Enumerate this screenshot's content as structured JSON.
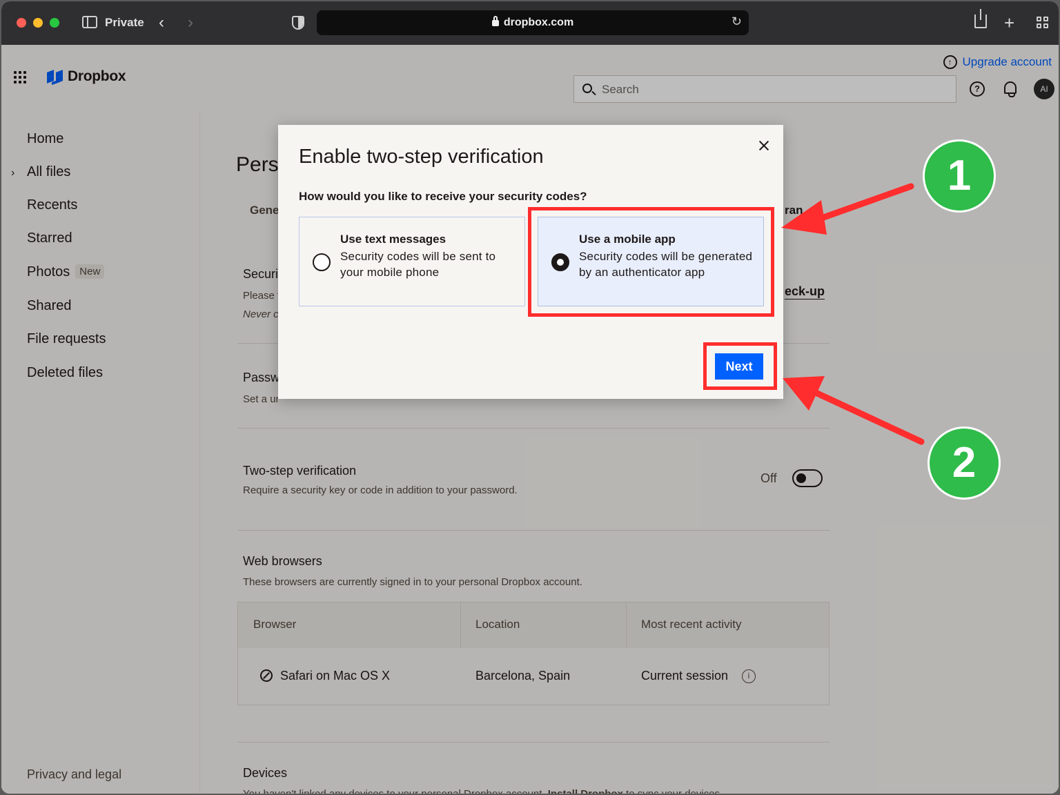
{
  "browser": {
    "mode_label": "Private",
    "url": "dropbox.com"
  },
  "header": {
    "logo_text": "Dropbox",
    "upgrade_label": "Upgrade account",
    "search_placeholder": "Search",
    "avatar_initials": "AI"
  },
  "sidebar": {
    "items": [
      {
        "label": "Home"
      },
      {
        "label": "All files"
      },
      {
        "label": "Recents"
      },
      {
        "label": "Starred"
      },
      {
        "label": "Photos",
        "badge": "New"
      },
      {
        "label": "Shared"
      },
      {
        "label": "File requests"
      },
      {
        "label": "Deleted files"
      }
    ],
    "footer_label": "Privacy and legal"
  },
  "main": {
    "title_partial": "Pers",
    "tab_general_partial": "Gene",
    "tab_branding_partial": "ran",
    "security": {
      "heading_partial": "Securi",
      "line1_partial": "Please t",
      "line2_partial": "Never c",
      "checkup_partial": "eck-up"
    },
    "password": {
      "heading_partial": "Passw",
      "desc_partial": "Set a ur"
    },
    "two_step": {
      "heading": "Two-step verification",
      "desc": "Require a security key or code in addition to your password.",
      "status": "Off"
    },
    "web_browsers": {
      "heading": "Web browsers",
      "desc": "These browsers are currently signed in to your personal Dropbox account.",
      "columns": [
        "Browser",
        "Location",
        "Most recent activity"
      ],
      "rows": [
        {
          "browser": "Safari on Mac OS X",
          "location": "Barcelona, Spain",
          "activity": "Current session"
        }
      ]
    },
    "devices": {
      "heading": "Devices",
      "desc_partial": "You haven't linked any devices to your personal Dropbox account.",
      "desc_link": "Install Dropbox",
      "desc_tail": "to sync your devices."
    }
  },
  "modal": {
    "title": "Enable two-step verification",
    "question": "How would you like to receive your security codes?",
    "options": [
      {
        "title": "Use text messages",
        "description": "Security codes will be sent to your mobile phone",
        "selected": false
      },
      {
        "title": "Use a mobile app",
        "description": "Security codes will be generated by an authenticator app",
        "selected": true
      }
    ],
    "next_label": "Next"
  },
  "annotations": {
    "step1": "1",
    "step2": "2",
    "highlight_color": "#ff2d2d",
    "badge_color": "#2fbc4a"
  },
  "colors": {
    "accent": "#0061fe",
    "text": "#1e1919",
    "background": "#f7f5f2"
  }
}
